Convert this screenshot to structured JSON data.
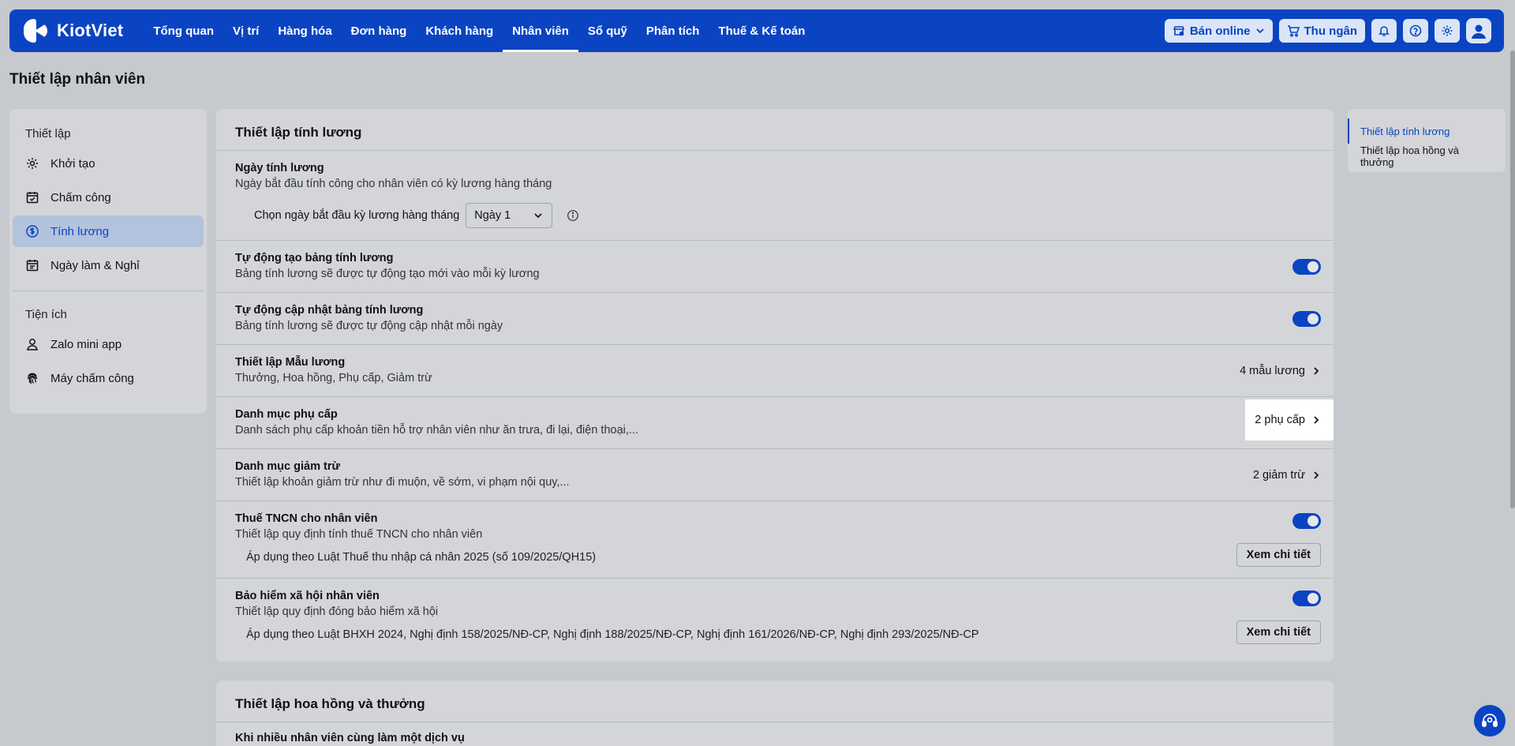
{
  "brand": {
    "name": "KiotViet",
    "accent": "#0a44c2"
  },
  "nav": {
    "items": [
      {
        "label": "Tổng quan"
      },
      {
        "label": "Vị trí"
      },
      {
        "label": "Hàng hóa"
      },
      {
        "label": "Đơn hàng"
      },
      {
        "label": "Khách hàng"
      },
      {
        "label": "Nhân viên"
      },
      {
        "label": "Sổ quỹ"
      },
      {
        "label": "Phân tích"
      },
      {
        "label": "Thuế & Kế toán"
      }
    ],
    "sell_online": "Bán online",
    "cashier": "Thu ngân"
  },
  "page": {
    "title": "Thiết lập nhân viên"
  },
  "sidebar": {
    "section1": "Thiết lập",
    "items1": [
      {
        "label": "Khởi tạo",
        "icon": "gear-icon"
      },
      {
        "label": "Chấm công",
        "icon": "calendar-check-icon"
      },
      {
        "label": "Tính lương",
        "icon": "dollar-circle-icon"
      },
      {
        "label": "Ngày làm & Nghỉ",
        "icon": "calendar-icon"
      }
    ],
    "section2": "Tiện ích",
    "items2": [
      {
        "label": "Zalo mini app",
        "icon": "user-icon"
      },
      {
        "label": "Máy chấm công",
        "icon": "fingerprint-icon"
      }
    ]
  },
  "payroll": {
    "title": "Thiết lập tính lương",
    "payday": {
      "title": "Ngày tính lương",
      "desc": "Ngày bắt đầu tính công cho nhân viên có kỳ lương hàng tháng",
      "select_label": "Chọn ngày bắt đầu kỳ lương hàng tháng",
      "select_value": "Ngày 1"
    },
    "auto_create": {
      "title": "Tự động tạo bảng tính lương",
      "desc": "Bảng tính lương sẽ được tự động tạo mới vào mỗi kỳ lương",
      "enabled": true
    },
    "auto_update": {
      "title": "Tự động cập nhật bảng tính lương",
      "desc": "Bảng tính lương sẽ được tự động cập nhật mỗi ngày",
      "enabled": true
    },
    "templates": {
      "title": "Thiết lập Mẫu lương",
      "desc": "Thưởng, Hoa hồng, Phụ cấp, Giảm trừ",
      "link": "4 mẫu lương"
    },
    "allowances": {
      "title": "Danh mục phụ cấp",
      "desc": "Danh sách phụ cấp khoản tiền hỗ trợ nhân viên như ăn trưa, đi lại, điện thoại,...",
      "link": "2 phụ cấp"
    },
    "deductions": {
      "title": "Danh mục giảm trừ",
      "desc": "Thiết lập khoản giảm trừ như đi muộn, về sớm, vi phạm nội quy,...",
      "link": "2 giảm trừ"
    },
    "pit": {
      "title": "Thuế TNCN cho nhân viên",
      "desc": "Thiết lập quy định tính thuế TNCN cho nhân viên",
      "sub": "Áp dụng theo Luật Thuế thu nhập cá nhân 2025 (số 109/2025/QH15)",
      "button": "Xem chi tiết",
      "enabled": true
    },
    "insurance": {
      "title": "Bảo hiểm xã hội nhân viên",
      "desc": "Thiết lập quy định đóng bảo hiểm xã hội",
      "sub": "Áp dụng theo Luật BHXH 2024, Nghị định 158/2025/NĐ-CP, Nghị định 188/2025/NĐ-CP, Nghị định 161/2026/NĐ-CP, Nghị định 293/2025/NĐ-CP",
      "button": "Xem chi tiết",
      "enabled": true
    }
  },
  "commission": {
    "title": "Thiết lập hoa hồng và thưởng",
    "first_row": "Khi nhiều nhân viên cùng làm một dịch vụ"
  },
  "toc": {
    "items": [
      {
        "label": "Thiết lập tính lương"
      },
      {
        "label": "Thiết lập hoa hồng và thưởng"
      }
    ]
  }
}
